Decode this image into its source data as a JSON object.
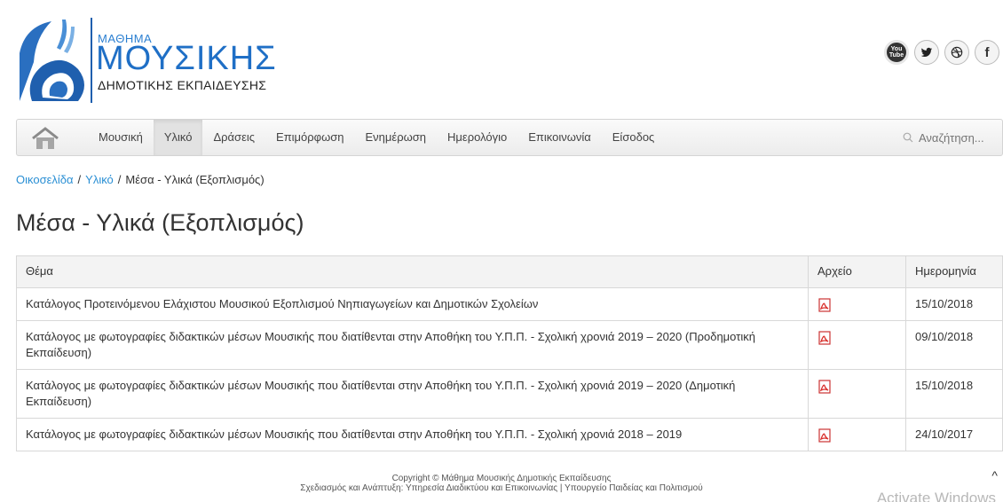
{
  "header": {
    "logo_small": "ΜΑΘΗΜΑ",
    "logo_big": "ΜΟΥΣΙΚΗΣ",
    "logo_sub": "ΔΗΜΟΤΙΚΗΣ ΕΚΠΑΙΔΕΥΣΗΣ",
    "social": [
      {
        "icon": "youtube-icon",
        "label": "You Tube"
      },
      {
        "icon": "twitter-icon",
        "label": ""
      },
      {
        "icon": "dribbble-icon",
        "label": ""
      },
      {
        "icon": "facebook-icon",
        "label": "f"
      }
    ]
  },
  "nav": {
    "items": [
      "Μουσική",
      "Υλικό",
      "Δράσεις",
      "Επιμόρφωση",
      "Ενημέρωση",
      "Ημερολόγιο",
      "Επικοινωνία",
      "Είσοδος"
    ],
    "active_index": 1,
    "search_placeholder": "Αναζήτηση..."
  },
  "breadcrumb": {
    "home": "Οικοσελίδα",
    "section": "Υλικό",
    "current": "Μέσα - Υλικά (Εξοπλισμός)",
    "separator": "/"
  },
  "page_title": "Μέσα - Υλικά (Εξοπλισμός)",
  "table": {
    "headers": [
      "Θέμα",
      "Αρχείο",
      "Ημερομηνία"
    ],
    "rows": [
      {
        "topic": "Κατάλογος Προτεινόμενου Ελάχιστου Μουσικού Εξοπλισμού Νηπιαγωγείων και Δημοτικών Σχολείων",
        "date": "15/10/2018"
      },
      {
        "topic": "Κατάλογος με φωτογραφίες διδακτικών μέσων Μουσικής που διατίθενται στην Αποθήκη του Υ.Π.Π. - Σχολική χρονιά 2019 – 2020 (Προδημοτική Εκπαίδευση)",
        "date": "09/10/2018"
      },
      {
        "topic": "Κατάλογος με φωτογραφίες διδακτικών μέσων Μουσικής που διατίθενται στην Αποθήκη του Υ.Π.Π. - Σχολική χρονιά 2019 – 2020 (Δημοτική Εκπαίδευση)",
        "date": "15/10/2018"
      },
      {
        "topic": "Κατάλογος με φωτογραφίες διδακτικών μέσων Μουσικής που διατίθενται στην Αποθήκη του Υ.Π.Π. - Σχολική χρονιά 2018 – 2019",
        "date": "24/10/2017"
      }
    ],
    "file_icon": "pdf-icon"
  },
  "footer": {
    "line1": "Copyright ©  Μάθημα Μουσικής Δημοτικής Εκπαίδευσης",
    "line2": "Σχεδιασμός και Ανάπτυξη: Υπηρεσία Διαδικτύου και Επικοινωνίας | Υπουργείο Παιδείας και Πολιτισμού"
  },
  "overlay": {
    "scroll_up": "^",
    "watermark": "Activate Windows"
  },
  "colors": {
    "brand_blue": "#1f6fc6",
    "link_blue": "#2a8fd4",
    "pdf_red": "#d9302c"
  }
}
